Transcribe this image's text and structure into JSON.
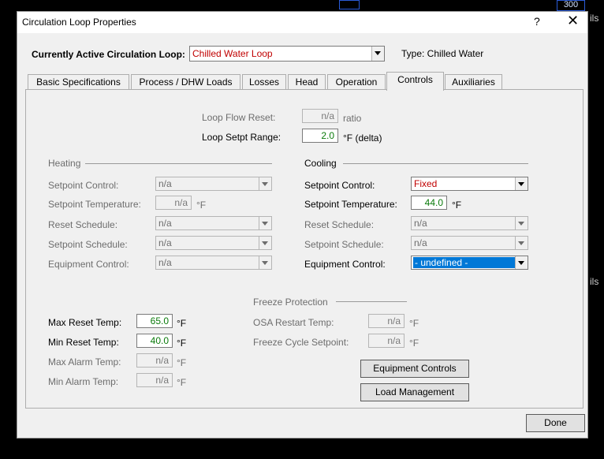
{
  "background": {
    "right_text_top": "ils",
    "right_text_mid": "ils",
    "number_box": "300"
  },
  "dialog": {
    "title": "Circulation Loop Properties",
    "help_label": "?",
    "close_label": "✕",
    "active_loop_label": "Currently Active Circulation Loop:",
    "active_loop_value": "Chilled Water Loop",
    "type_text": "Type: Chilled Water",
    "tabs": [
      "Basic Specifications",
      "Process / DHW Loads",
      "Losses",
      "Head",
      "Operation",
      "Controls",
      "Auxiliaries"
    ],
    "active_tab": "Controls",
    "loop_flow_reset": {
      "label": "Loop Flow Reset:",
      "value": "n/a",
      "unit": "ratio"
    },
    "loop_setpt_range": {
      "label": "Loop Setpt Range:",
      "value": "2.0",
      "unit": "°F (delta)"
    },
    "heating": {
      "header": "Heating",
      "setpoint_control": {
        "label": "Setpoint Control:",
        "value": "n/a"
      },
      "setpoint_temperature": {
        "label": "Setpoint Temperature:",
        "value": "n/a",
        "unit": "°F"
      },
      "reset_schedule": {
        "label": "Reset Schedule:",
        "value": "n/a"
      },
      "setpoint_schedule": {
        "label": "Setpoint Schedule:",
        "value": "n/a"
      },
      "equipment_control": {
        "label": "Equipment Control:",
        "value": "n/a"
      }
    },
    "cooling": {
      "header": "Cooling",
      "setpoint_control": {
        "label": "Setpoint Control:",
        "value": "Fixed"
      },
      "setpoint_temperature": {
        "label": "Setpoint Temperature:",
        "value": "44.0",
        "unit": "°F"
      },
      "reset_schedule": {
        "label": "Reset Schedule:",
        "value": "n/a"
      },
      "setpoint_schedule": {
        "label": "Setpoint Schedule:",
        "value": "n/a"
      },
      "equipment_control": {
        "label": "Equipment Control:",
        "value": "- undefined -"
      }
    },
    "reset": {
      "max_reset": {
        "label": "Max Reset Temp:",
        "value": "65.0",
        "unit": "°F"
      },
      "min_reset": {
        "label": "Min Reset Temp:",
        "value": "40.0",
        "unit": "°F"
      },
      "max_alarm": {
        "label": "Max Alarm Temp:",
        "value": "n/a",
        "unit": "°F"
      },
      "min_alarm": {
        "label": "Min Alarm Temp:",
        "value": "n/a",
        "unit": "°F"
      }
    },
    "freeze": {
      "header": "Freeze Protection",
      "osa_restart": {
        "label": "OSA Restart Temp:",
        "value": "n/a",
        "unit": "°F"
      },
      "freeze_cycle": {
        "label": "Freeze Cycle Setpoint:",
        "value": "n/a",
        "unit": "°F"
      }
    },
    "equipment_controls_button": "Equipment Controls",
    "load_management_button": "Load Management",
    "done_button": "Done"
  }
}
